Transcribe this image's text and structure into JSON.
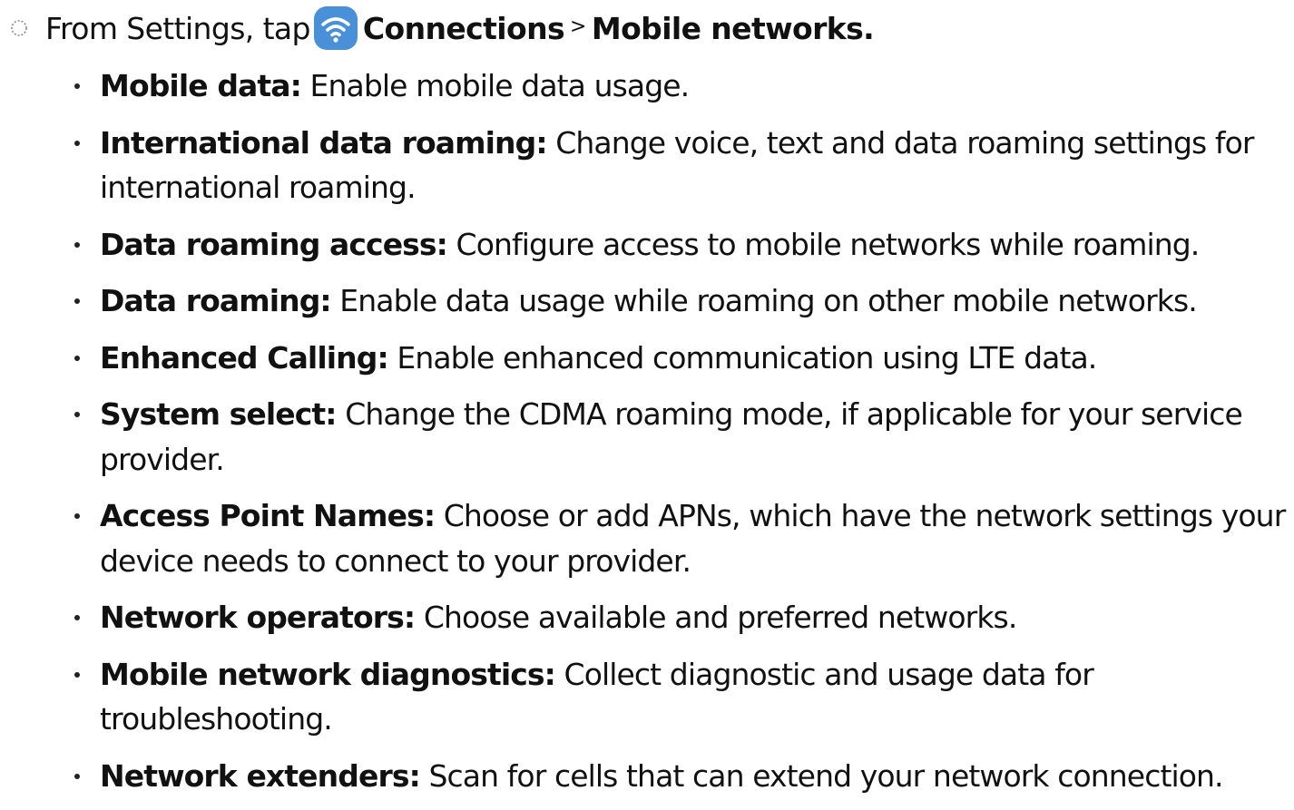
{
  "step": {
    "prefix": "From Settings, tap",
    "icon": "wifi-icon",
    "connections": "Connections",
    "separator": ">",
    "mobile_networks": "Mobile networks."
  },
  "items": [
    {
      "term": "Mobile data:",
      "desc": " Enable mobile data usage."
    },
    {
      "term": "International data roaming:",
      "desc": " Change voice, text and data roaming settings for international roaming."
    },
    {
      "term": "Data roaming access:",
      "desc": " Configure access to mobile networks while roaming."
    },
    {
      "term": "Data roaming:",
      "desc": " Enable data usage while roaming on other mobile networks."
    },
    {
      "term": "Enhanced Calling:",
      "desc": " Enable enhanced communication using LTE data."
    },
    {
      "term": "System select:",
      "desc": " Change the CDMA roaming mode, if applicable for your service provider."
    },
    {
      "term": "Access Point Names:",
      "desc": " Choose or add APNs, which have the network settings your device needs to connect to your provider."
    },
    {
      "term": "Network operators:",
      "desc": " Choose available and preferred networks."
    },
    {
      "term": "Mobile network diagnostics:",
      "desc": " Collect diagnostic and usage data for troubleshooting."
    },
    {
      "term": "Network extenders:",
      "desc": " Scan for cells that can extend your network connection."
    }
  ],
  "colors": {
    "icon_background": "#4a90d9",
    "icon_foreground": "#ffffff"
  }
}
